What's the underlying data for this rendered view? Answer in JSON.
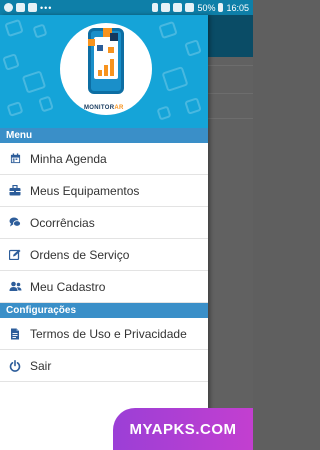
{
  "status_bar": {
    "battery": "50%",
    "time": "16:05"
  },
  "header": {
    "logo_text_a": "MONITOR",
    "logo_text_b": "AR"
  },
  "sections": {
    "menu": "Menu",
    "config": "Configurações"
  },
  "menu_items": [
    {
      "label": "Minha Agenda",
      "icon": "calendar-icon"
    },
    {
      "label": "Meus Equipamentos",
      "icon": "toolbox-icon"
    },
    {
      "label": "Ocorrências",
      "icon": "chat-icon"
    },
    {
      "label": "Ordens de Serviço",
      "icon": "edit-icon"
    },
    {
      "label": "Meu Cadastro",
      "icon": "users-icon"
    }
  ],
  "config_items": [
    {
      "label": "Termos de Uso e Privacidade",
      "icon": "document-icon"
    },
    {
      "label": "Sair",
      "icon": "power-icon"
    }
  ],
  "watermark": "MYAPKS.COM",
  "colors": {
    "status_bar": "#0e7fa8",
    "header_bg": "#15a4d8",
    "section_bg": "#3a8fc8",
    "icon": "#2d5d9a",
    "logo_accent": "#f7931e"
  }
}
